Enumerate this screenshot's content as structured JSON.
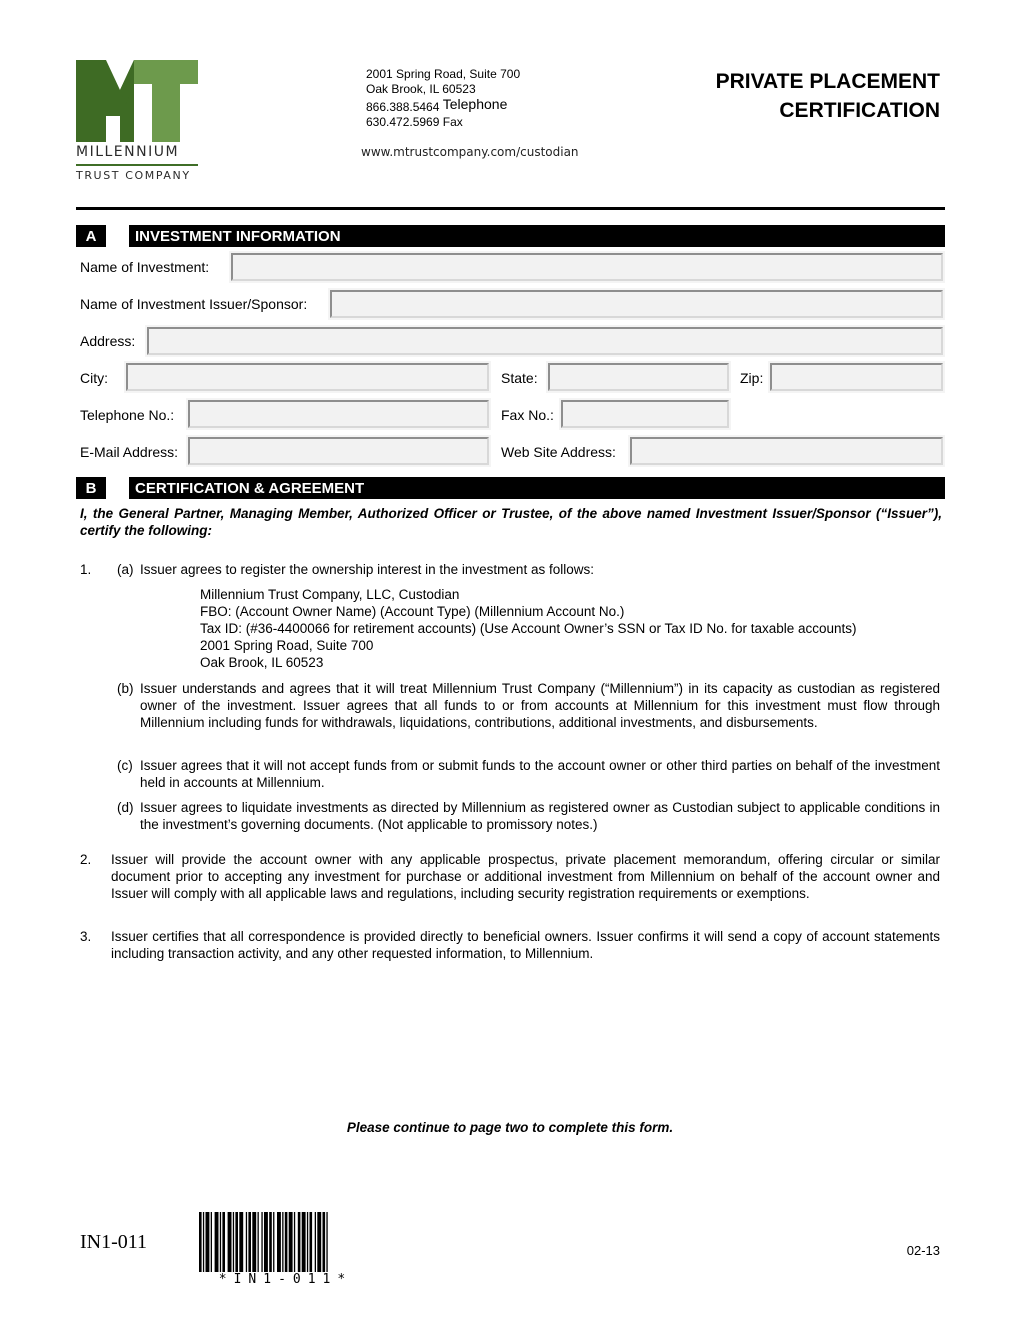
{
  "logo": {
    "monogram": "MT",
    "name": "MILLENNIUM",
    "subtitle": "TRUST COMPANY",
    "colors": {
      "dark_green": "#3e6b24",
      "light_green": "#6d9a4c"
    }
  },
  "contact": {
    "address_line1": "2001 Spring Road, Suite 700",
    "address_line2": "Oak Brook, IL 60523",
    "telephone": "866.388.5464",
    "telephone_label": "Telephone",
    "fax": "630.472.5969 Fax",
    "website": "www.mtrustcompany.com/custodian"
  },
  "title": {
    "line1": "PRIVATE PLACEMENT",
    "line2": "CERTIFICATION"
  },
  "section_a": {
    "letter": "A",
    "heading": "INVESTMENT INFORMATION",
    "fields": {
      "name_of_investment": {
        "label": "Name of Investment:",
        "value": ""
      },
      "issuer_sponsor": {
        "label": "Name of Investment Issuer/Sponsor:",
        "value": ""
      },
      "address": {
        "label": "Address:",
        "value": ""
      },
      "city": {
        "label": "City:",
        "value": ""
      },
      "state": {
        "label": "State:",
        "value": ""
      },
      "zip": {
        "label": "Zip:",
        "value": ""
      },
      "telephone": {
        "label": "Telephone No.:",
        "value": ""
      },
      "fax": {
        "label": "Fax No.:",
        "value": ""
      },
      "email": {
        "label": "E-Mail Address:",
        "value": ""
      },
      "website": {
        "label": "Web Site Address:",
        "value": ""
      }
    }
  },
  "section_b": {
    "letter": "B",
    "heading": "CERTIFICATION & AGREEMENT",
    "intro": "I, the General Partner, Managing Member, Authorized Officer or Trustee, of the above named Investment Issuer/Sponsor (“Issuer”), certify the following:",
    "item1": {
      "number": "1.",
      "a_label": "(a)",
      "a_text": "Issuer agrees to register the ownership interest in the investment as follows:",
      "registration_lines": [
        "Millennium Trust Company, LLC, Custodian",
        "FBO: (Account Owner Name) (Account Type) (Millennium Account No.)",
        "Tax ID: (#36-4400066 for retirement accounts) (Use Account Owner’s SSN or Tax ID No. for taxable accounts)",
        "2001 Spring Road, Suite 700",
        "Oak Brook, IL 60523"
      ],
      "b_label": "(b)",
      "b_text": "Issuer understands and agrees that it will treat Millennium Trust Company (“Millennium”) in its capacity as custodian as registered owner of the investment. Issuer agrees that all funds to or from accounts at Millennium for this investment must flow through Millennium including funds for withdrawals, liquidations, contributions, additional investments, and disbursements.",
      "c_label": "(c)",
      "c_text": "Issuer agrees that it will not accept funds from or submit funds to the account owner or other third parties on behalf of the investment held in accounts at Millennium.",
      "d_label": "(d)",
      "d_text": "Issuer agrees to liquidate investments as directed by Millennium as registered owner as Custodian subject to applicable conditions in the investment’s governing documents. (Not applicable to promissory notes.)"
    },
    "item2": {
      "number": "2.",
      "text": "Issuer will provide the account owner with any applicable prospectus, private placement memorandum, offering circular or similar document prior to accepting any investment for purchase or additional investment from Millennium on behalf of the account owner and Issuer will comply with all applicable laws and regulations, including security registration requirements or exemptions."
    },
    "item3": {
      "number": "3.",
      "text": "Issuer certifies that all correspondence is provided directly to beneficial owners. Issuer confirms it will send a copy of account statements including transaction activity, and any other requested information, to Millennium."
    }
  },
  "footer": {
    "continue_note": "Please continue to page two to complete this form.",
    "form_id": "IN1-011",
    "barcode_text": "*IN1-011*",
    "revision": "02-13"
  }
}
